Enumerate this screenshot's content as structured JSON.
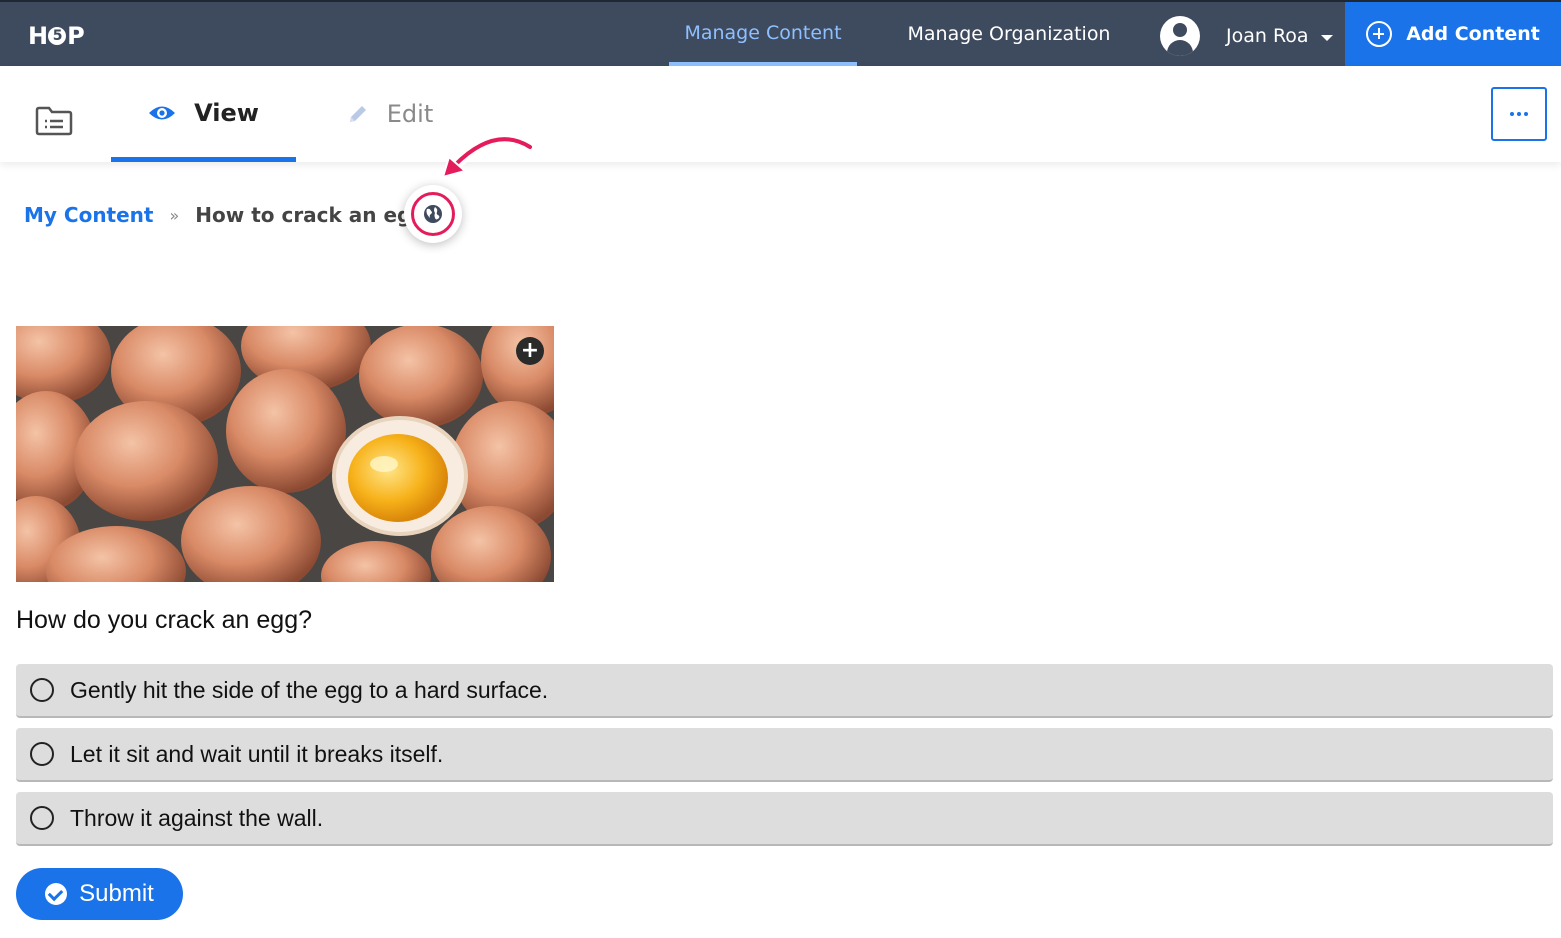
{
  "header": {
    "logo_text": "H5P",
    "nav": [
      {
        "label": "Manage Content",
        "active": true
      },
      {
        "label": "Manage Organization",
        "active": false
      }
    ],
    "user_name": "Joan Roa",
    "add_content_label": "Add Content"
  },
  "tabs": {
    "view_label": "View",
    "edit_label": "Edit",
    "active": "View"
  },
  "breadcrumb": {
    "parent": "My Content",
    "separator": "»",
    "current": "How to crack an egg"
  },
  "question": {
    "prompt": "How do you crack an egg?",
    "options": [
      "Gently hit the side of the egg to a hard surface.",
      "Let it sit and wait until it breaks itself.",
      "Throw it against the wall."
    ],
    "submit_label": "Submit"
  },
  "colors": {
    "topbar": "#3e4a5e",
    "accent": "#1a73e8",
    "highlight": "#e51c5c",
    "option_bg": "#dddddd"
  },
  "icons": [
    "folder-list-icon",
    "eye-icon",
    "pencil-icon",
    "more-icon",
    "globe-icon",
    "plus-circle-icon",
    "user-avatar-icon",
    "check-circle-icon"
  ]
}
